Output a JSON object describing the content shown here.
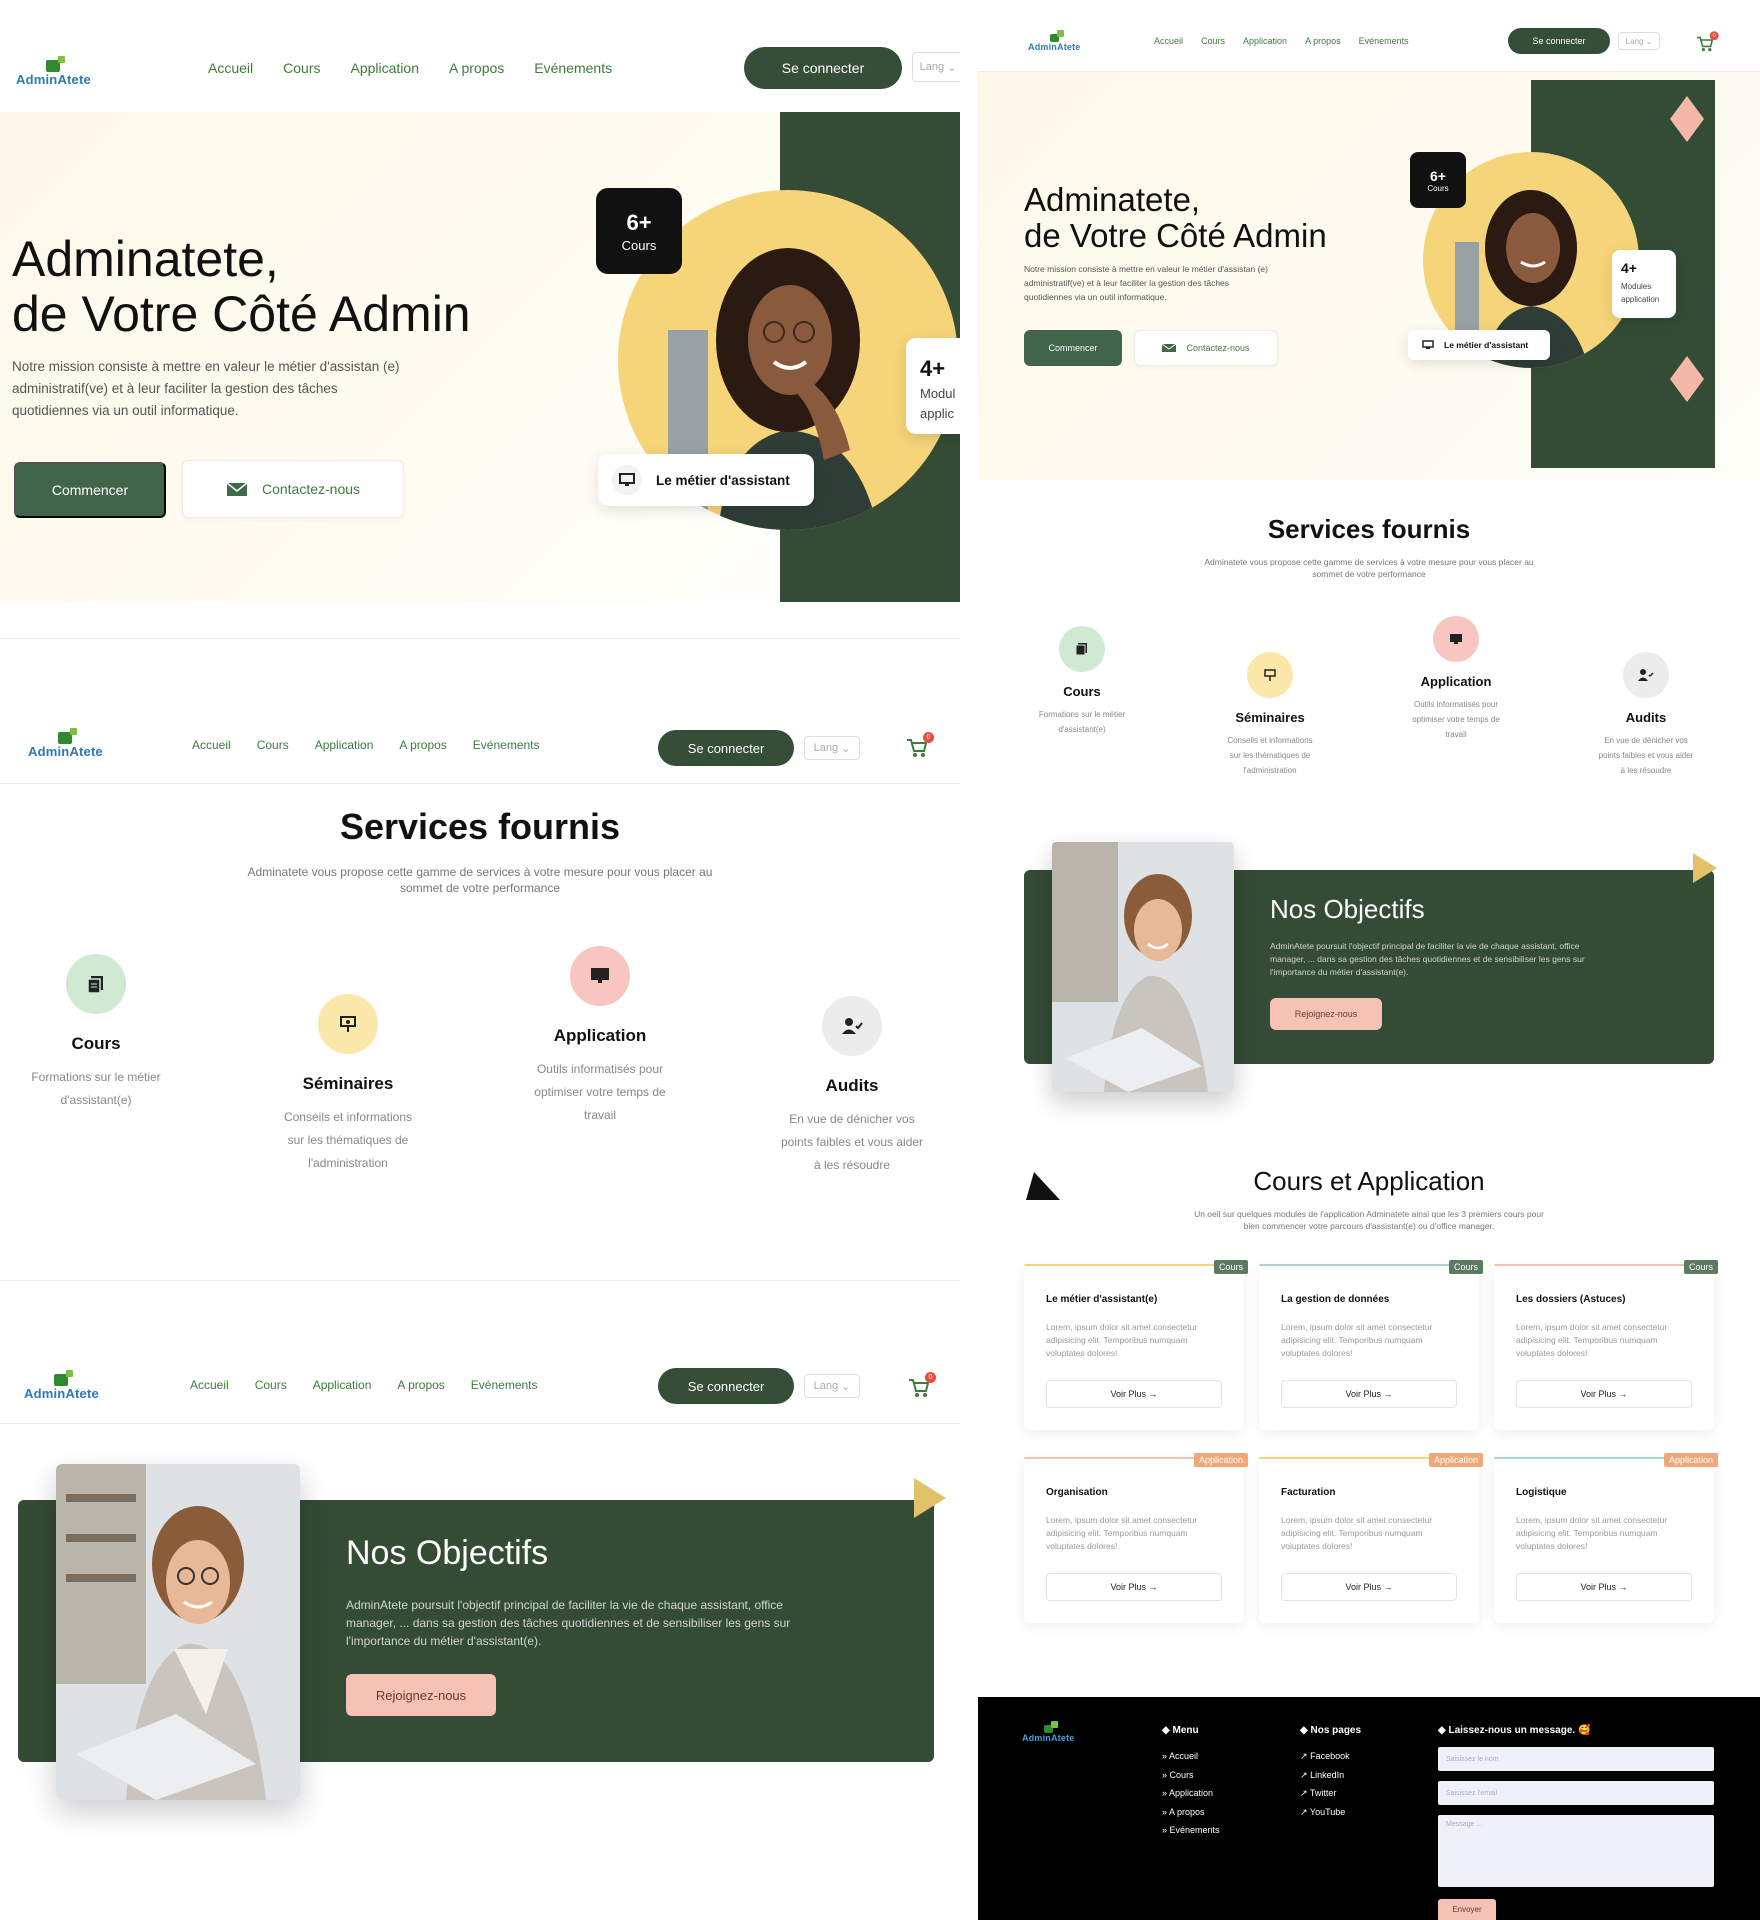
{
  "brand": {
    "name": "AdminAtete"
  },
  "nav": {
    "links": [
      "Accueil",
      "Cours",
      "Application",
      "A propos",
      "Evénements"
    ],
    "login": "Se connecter",
    "lang": "Lang",
    "cart_count": "0"
  },
  "hero": {
    "title_line1": "Adminatete,",
    "title_line2": "de Votre Côté Admin",
    "desc_line1": "Notre mission consiste à mettre en valeur le métier d'assistan (e)",
    "desc_line2": "administratif(ve) et à leur faciliter la gestion des tâches",
    "desc_line3": "quotidiennes via un outil informatique.",
    "desc_r1": "Notre mission consiste à mettre en valeur le métier d'assistan (e)",
    "desc_r2": "administratif(ve) et à leur faciliter la gestion des tâches",
    "desc_r3": "quotidiennes via un outil informatique.",
    "start": "Commencer",
    "contact": "Contactez-nous",
    "badge_courses_num": "6+",
    "badge_courses_label": "Cours",
    "badge_modules_num": "4+",
    "badge_modules_label_1": "Modul",
    "badge_modules_label_2": "applic",
    "badge_modules_full_1": "Modules",
    "badge_modules_full_2": "application",
    "card_label": "Le métier d'assistant"
  },
  "services": {
    "title": "Services fournis",
    "sub_line1": "Adminatete vous propose cette gamme de services à votre mesure pour vous placer au",
    "sub_line2": "sommet de votre performance",
    "items": [
      {
        "title": "Cours",
        "d1": "Formations sur le métier",
        "d2": "d'assistant(e)",
        "d3": ""
      },
      {
        "title": "Séminaires",
        "d1": "Conseils et informations",
        "d2": "sur les thématiques de",
        "d3": "l'administration"
      },
      {
        "title": "Application",
        "d1": "Outils informatisés pour",
        "d2": "optimiser votre temps de",
        "d3": "travail"
      },
      {
        "title": "Audits",
        "d1": "En vue de dénicher vos",
        "d2": "points faibles et vous aider",
        "d3": "à les résoudre"
      }
    ]
  },
  "objectifs": {
    "title": "Nos Objectifs",
    "l1": "AdminAtete poursuit l'objectif principal de faciliter la vie de chaque assistant, office",
    "l2": "manager, ... dans sa gestion des tâches quotidiennes et de sensibiliser les gens sur",
    "l3": "l'importance du métier d'assistant(e).",
    "cta": "Rejoignez-nous"
  },
  "courses": {
    "title": "Cours et Application",
    "sub1": "Un oeil sur quelques modules de l'application Adminatete ainsi que les 3 premiers cours pour",
    "sub2": "bien commencer votre parcours d'assistant(e) ou d'office manager.",
    "lorem1": "Lorem, ipsum dolor sit amet consectetur",
    "lorem2": "adipisicing elit. Temporibus numquam",
    "lorem3": "voluptates dolores!",
    "more": "Voir Plus →",
    "tag_course": "Cours",
    "tag_app": "Application",
    "cards": [
      {
        "title": "Le métier d'assistant(e)"
      },
      {
        "title": "La gestion de données"
      },
      {
        "title": "Les dossiers (Astuces)"
      },
      {
        "title": "Organisation"
      },
      {
        "title": "Facturation"
      },
      {
        "title": "Logistique"
      }
    ]
  },
  "footer": {
    "menu_title": "Menu",
    "menu": [
      "Accueil",
      "Cours",
      "Application",
      "A propos",
      "Evénements"
    ],
    "pages_title": "Nos pages",
    "pages": [
      "Facebook",
      "LinkedIn",
      "Twitter",
      "YouTube"
    ],
    "msg_title": "Laissez-nous un message. 🥰",
    "ph_name": "Saisissez le nom",
    "ph_email": "Saisissez l'email",
    "ph_msg": "Message ...",
    "send": "Envoyer"
  },
  "colors": {
    "primary": "#344b35",
    "accent_yellow": "#f6d47a",
    "accent_pink": "#f6c2b6",
    "link_green": "#3e7b3e"
  }
}
